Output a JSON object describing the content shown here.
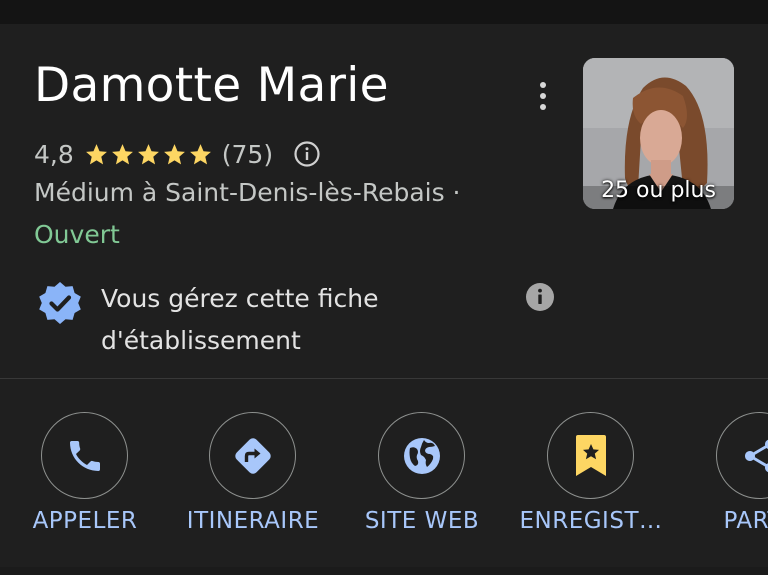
{
  "place": {
    "name": "Damotte Marie",
    "rating": "4,8",
    "stars": 5,
    "review_count": "(75)",
    "category": "Médium à Saint-Denis-lès-Rebais ·",
    "status": "Ouvert",
    "photo_count": "25 ou plus"
  },
  "management": {
    "text_line1": "Vous gérez cette fiche",
    "text_line2": "d'établissement"
  },
  "actions": [
    {
      "label": "APPELER",
      "icon": "phone-icon"
    },
    {
      "label": "ITINERAIRE",
      "icon": "directions-icon"
    },
    {
      "label": "SITE WEB",
      "icon": "globe-icon"
    },
    {
      "label": "ENREGIST…",
      "icon": "bookmark-star-icon"
    },
    {
      "label": "PARTA",
      "icon": "share-icon"
    }
  ],
  "colors": {
    "background": "#1f1f1f",
    "star": "#fdd663",
    "open_status": "#81c995",
    "action_label": "#a8c7fa",
    "verified_badge": "#8ab4f8",
    "bookmark": "#fdd663"
  }
}
